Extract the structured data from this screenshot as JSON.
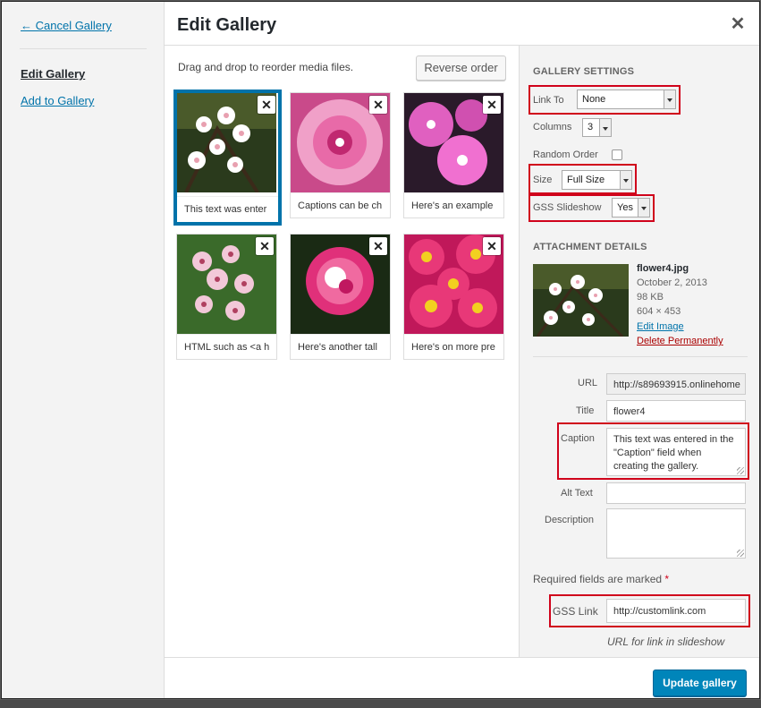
{
  "menu": {
    "cancel": "← Cancel Gallery",
    "items": [
      "Edit Gallery",
      "Add to Gallery"
    ]
  },
  "title": "Edit Gallery",
  "toolbar": {
    "instruction": "Drag and drop to reorder media files.",
    "reverse_label": "Reverse order"
  },
  "thumbnails": [
    {
      "caption": "This text was enter",
      "selected": true
    },
    {
      "caption": "Captions can be ch"
    },
    {
      "caption": "Here's an example"
    },
    {
      "caption": "HTML such as <a h"
    },
    {
      "caption": "Here's another tall"
    },
    {
      "caption": "Here's on more pre"
    }
  ],
  "settings": {
    "heading": "Gallery Settings",
    "link_to_label": "Link To",
    "link_to_value": "None",
    "columns_label": "Columns",
    "columns_value": "3",
    "random_label": "Random Order",
    "size_label": "Size",
    "size_value": "Full Size",
    "gss_label": "GSS Slideshow",
    "gss_value": "Yes"
  },
  "attachment": {
    "heading": "Attachment Details",
    "filename": "flower4.jpg",
    "date": "October 2, 2013",
    "filesize": "98 KB",
    "dimensions": "604 × 453",
    "edit_link": "Edit Image",
    "delete_link": "Delete Permanently",
    "url_label": "URL",
    "url_value": "http://s89693915.onlinehome",
    "title_label": "Title",
    "title_value": "flower4",
    "caption_label": "Caption",
    "caption_value": "This text was entered in the \"Caption\" field when creating the gallery.",
    "alt_label": "Alt Text",
    "alt_value": "",
    "description_label": "Description",
    "description_value": "",
    "required_text": "Required fields are marked",
    "required_star": "*",
    "gss_link_label": "GSS Link",
    "gss_link_value": "http://customlink.com",
    "gss_link_help": "URL for link in slideshow"
  },
  "footer": {
    "update_label": "Update gallery"
  },
  "colors": {
    "accent": "#0073aa",
    "primary_button": "#0085ba",
    "highlight_box": "#d0021b",
    "delete": "#aa0000"
  }
}
